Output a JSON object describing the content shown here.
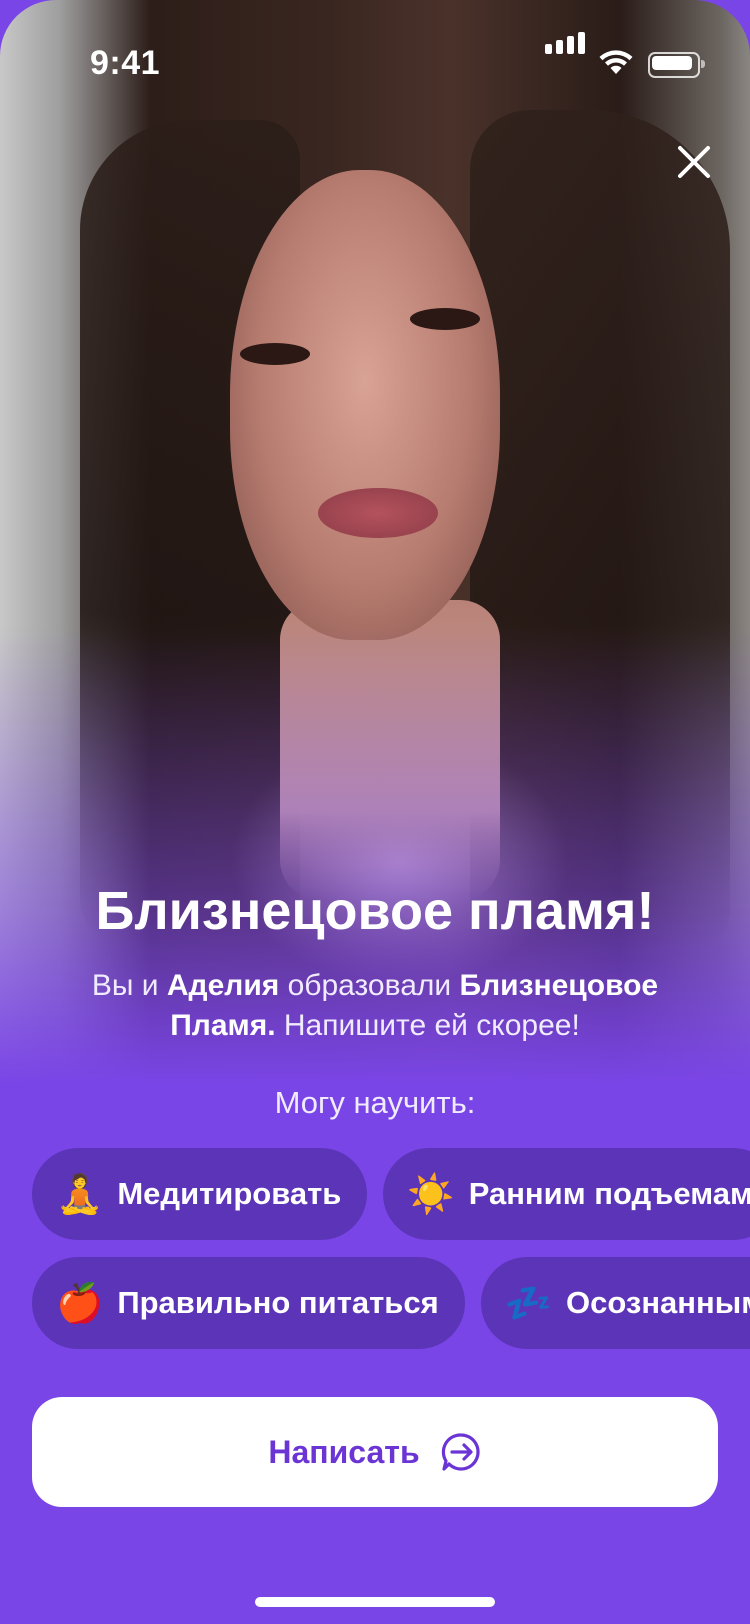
{
  "status_bar": {
    "time": "9:41"
  },
  "photo": {
    "description_icon": "profile-photo"
  },
  "match": {
    "title": "Близнецовое пламя!",
    "subtitle_prefix": "Вы и ",
    "partner_name": "Аделия",
    "subtitle_mid": " образовали ",
    "bond_name_line1": "Близнецовое",
    "bond_name_line2": "Пламя.",
    "subtitle_suffix": " Напишите ей скорее!"
  },
  "skills": {
    "label": "Могу научить:",
    "row1": [
      {
        "emoji": "🧘",
        "label": "Медитировать"
      },
      {
        "emoji": "☀️",
        "label": "Ранним подъемам"
      }
    ],
    "row2": [
      {
        "emoji": "🍎",
        "label": "Правильно питаться"
      },
      {
        "emoji": "💤",
        "label": "Осознанным снам"
      }
    ]
  },
  "actions": {
    "write_label": "Написать"
  },
  "colors": {
    "accent": "#7a45e6",
    "chip": "#5c34b8",
    "button_text": "#6b35d6"
  }
}
